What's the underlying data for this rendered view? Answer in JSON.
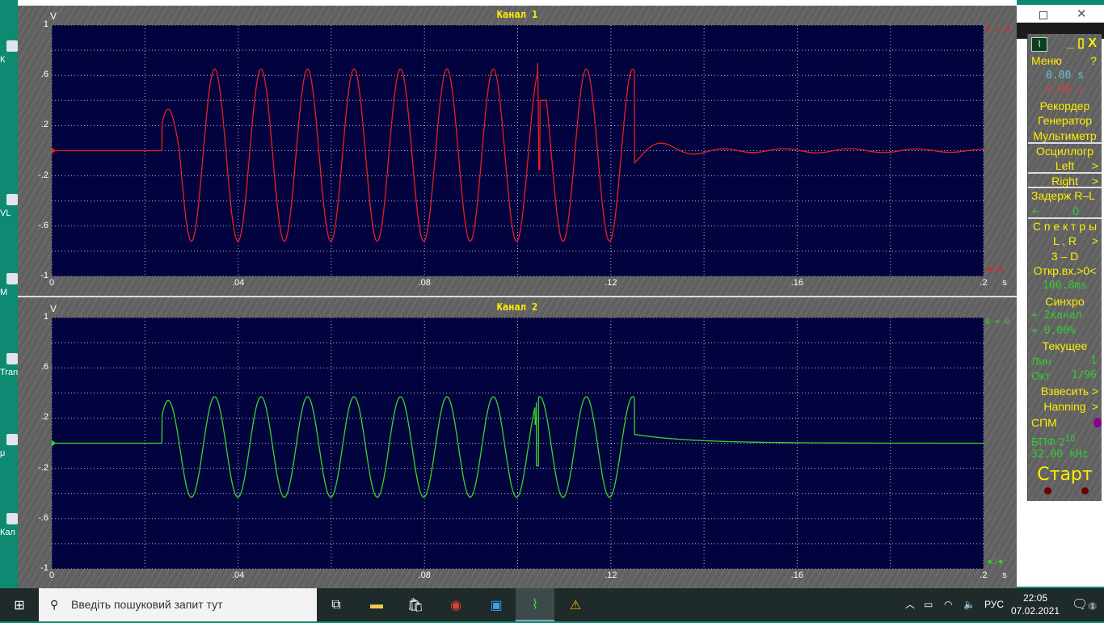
{
  "desktop_icons": [
    "К",
    "VL",
    "M",
    "Tran",
    "μ",
    "Кал"
  ],
  "channels": [
    {
      "title": "Канал 1",
      "unit": "V",
      "zero_readout": "0 = 0",
      "color": "#e8201c",
      "trigger_marker": "◂⎍◂"
    },
    {
      "title": "Канал 2",
      "unit": "V",
      "zero_readout": "0 = 0",
      "color": "#3ad42a",
      "trigger_marker": "◂⎍◂"
    }
  ],
  "axes": {
    "y_ticks": [
      "1",
      ".6",
      ".2",
      "-.2",
      "-.6",
      "-1"
    ],
    "x_ticks": [
      "0",
      ".04",
      ".08",
      ".12",
      ".16",
      ".2"
    ],
    "x_unit": "s"
  },
  "chart_data": {
    "type": "line",
    "xlabel": "s",
    "ylabel": "V",
    "xlim": [
      0,
      0.2
    ],
    "ylim": [
      -1,
      1
    ],
    "grid": true,
    "series": [
      {
        "name": "Канал 1",
        "start_s": 0.0237,
        "end_s": 0.1251,
        "freq_hz": 100.3,
        "amplitude_v": 0.685,
        "offset_v": -0.035,
        "first_peak_v": 0.33,
        "glitch_s": 0.1044
      },
      {
        "name": "Канал 2",
        "start_s": 0.0237,
        "end_s": 0.1251,
        "freq_hz": 100.3,
        "amplitude_v": 0.4,
        "offset_v": -0.03,
        "first_peak_v": 0.34,
        "glitch_s": 0.1037
      }
    ]
  },
  "side": {
    "menu": "Меню",
    "help": "?",
    "time1": "0.00",
    "time1_unit": "s",
    "time2": "0.00",
    "time2_unit": "s",
    "recorder": "Рекордер",
    "generator": "Генератор",
    "multimeter": "Мультиметр",
    "oscillograph": "Осциллогр",
    "left": "Left",
    "right": "Right",
    "arrow": ">",
    "delay": "Задерж  R–L",
    "delay_sign": "+",
    "delay_val": "0",
    "spectra": "С п е к т р ы",
    "lr": "L , R",
    "three_d": "3 – D",
    "open_input": "Откр.вх.>0<",
    "window_ms": "100.0ms",
    "sync": "Синхро",
    "sync_ch": "+ 2канал",
    "sync_pct": "+ 0.00%",
    "current": "Текущее",
    "lin": "Лин",
    "lin_val": "1",
    "oct": "Окт",
    "oct_val": "1/96",
    "weigh": "Взвесить",
    "hanning": "Hanning",
    "spm": "СПМ",
    "fft": "БПФ  2",
    "fft_exp": "16",
    "rate": "32.00 kHz",
    "start": "Старт",
    "min": "_",
    "max": "▯",
    "close": "X"
  },
  "taskbar": {
    "search_placeholder": "Введіть пошуковий запит тут",
    "lang": "РУС",
    "time": "22:05",
    "date": "07.02.2021",
    "notifications": "1"
  }
}
